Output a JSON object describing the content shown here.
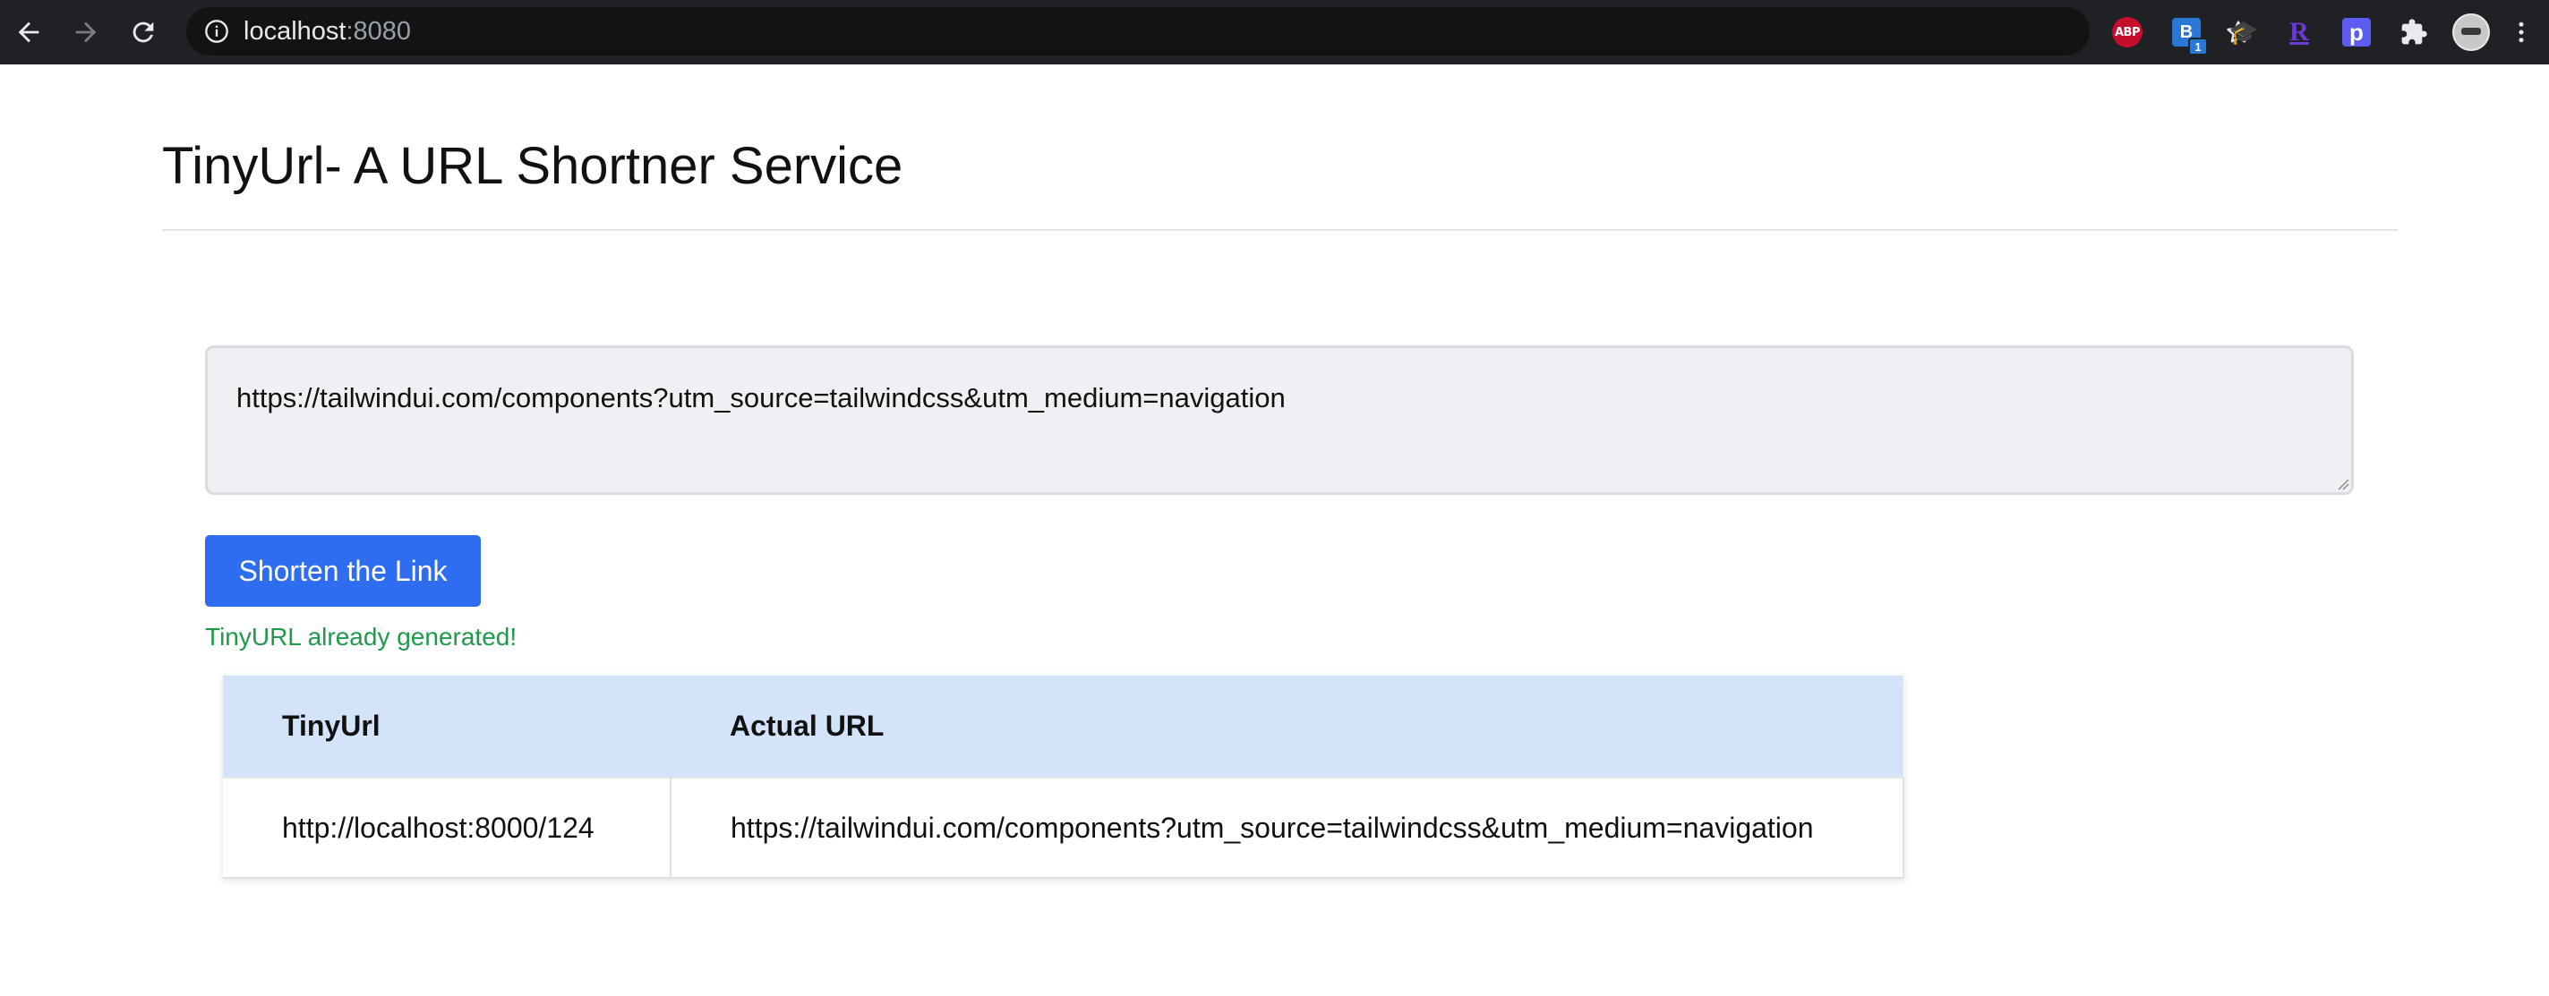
{
  "browser": {
    "url_host": "localhost",
    "url_port": ":8080",
    "extensions": {
      "abp_label": "ABP",
      "blue_ext_label": "B",
      "blue_ext_badge": "1",
      "r_ext_label": "R",
      "p_ext_label": "p"
    }
  },
  "page": {
    "title": "TinyUrl- A URL Shortner Service",
    "input_value": "https://tailwindui.com/components?utm_source=tailwindcss&utm_medium=navigation",
    "shorten_button_label": "Shorten the Link",
    "status_message": "TinyURL already generated!",
    "status_color": "#1f9a4a",
    "accent_color": "#2f6df0"
  },
  "table": {
    "headers": [
      "TinyUrl",
      "Actual URL"
    ],
    "rows": [
      [
        "http://localhost:8000/124",
        "https://tailwindui.com/components?utm_source=tailwindcss&utm_medium=navigation"
      ]
    ]
  }
}
